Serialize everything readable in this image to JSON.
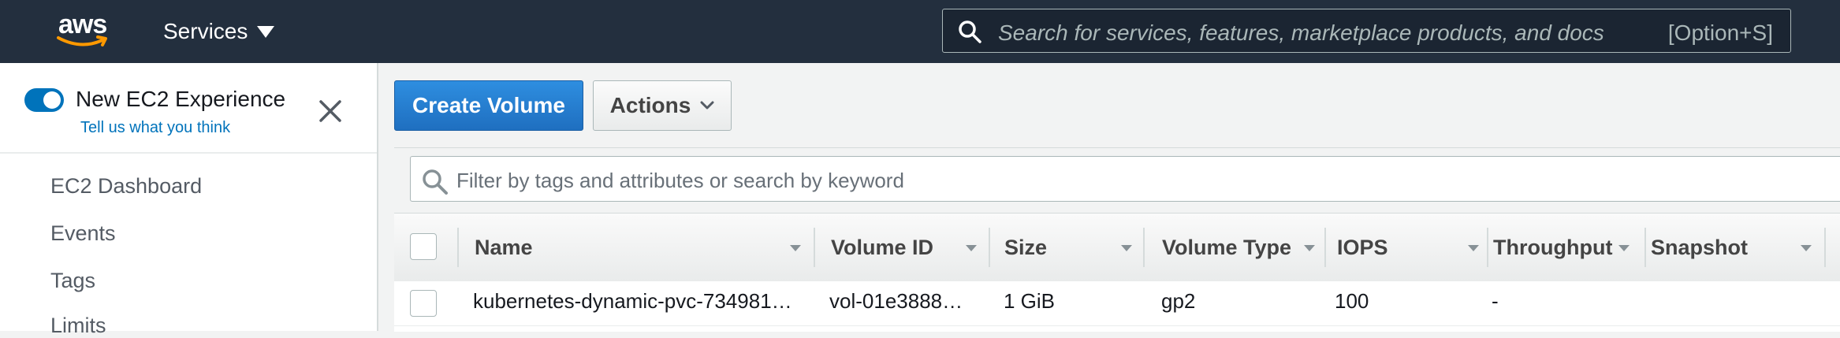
{
  "topnav": {
    "logo_text": "aws",
    "services_label": "Services",
    "search_placeholder": "Search for services, features, marketplace products, and docs",
    "search_shortcut": "[Option+S]"
  },
  "sidebar": {
    "new_experience_label": "New EC2 Experience",
    "feedback_link": "Tell us what you think",
    "new_experience_enabled": true,
    "items": [
      {
        "label": "EC2 Dashboard"
      },
      {
        "label": "Events"
      },
      {
        "label": "Tags"
      },
      {
        "label": "Limits"
      }
    ]
  },
  "toolbar": {
    "create_label": "Create Volume",
    "actions_label": "Actions"
  },
  "filter": {
    "placeholder": "Filter by tags and attributes or search by keyword"
  },
  "table": {
    "columns": [
      {
        "label": "Name"
      },
      {
        "label": "Volume ID"
      },
      {
        "label": "Size"
      },
      {
        "label": "Volume Type"
      },
      {
        "label": "IOPS"
      },
      {
        "label": "Throughput"
      },
      {
        "label": "Snapshot"
      }
    ],
    "rows": [
      {
        "name": "kubernetes-dynamic-pvc-734981…",
        "volume_id": "vol-01e3888…",
        "size": "1 GiB",
        "volume_type": "gp2",
        "iops": "100",
        "throughput": "-"
      }
    ]
  },
  "colors": {
    "nav_bg": "#232f3e",
    "primary": "#0073bb",
    "create_button": "#1f6fc0"
  }
}
